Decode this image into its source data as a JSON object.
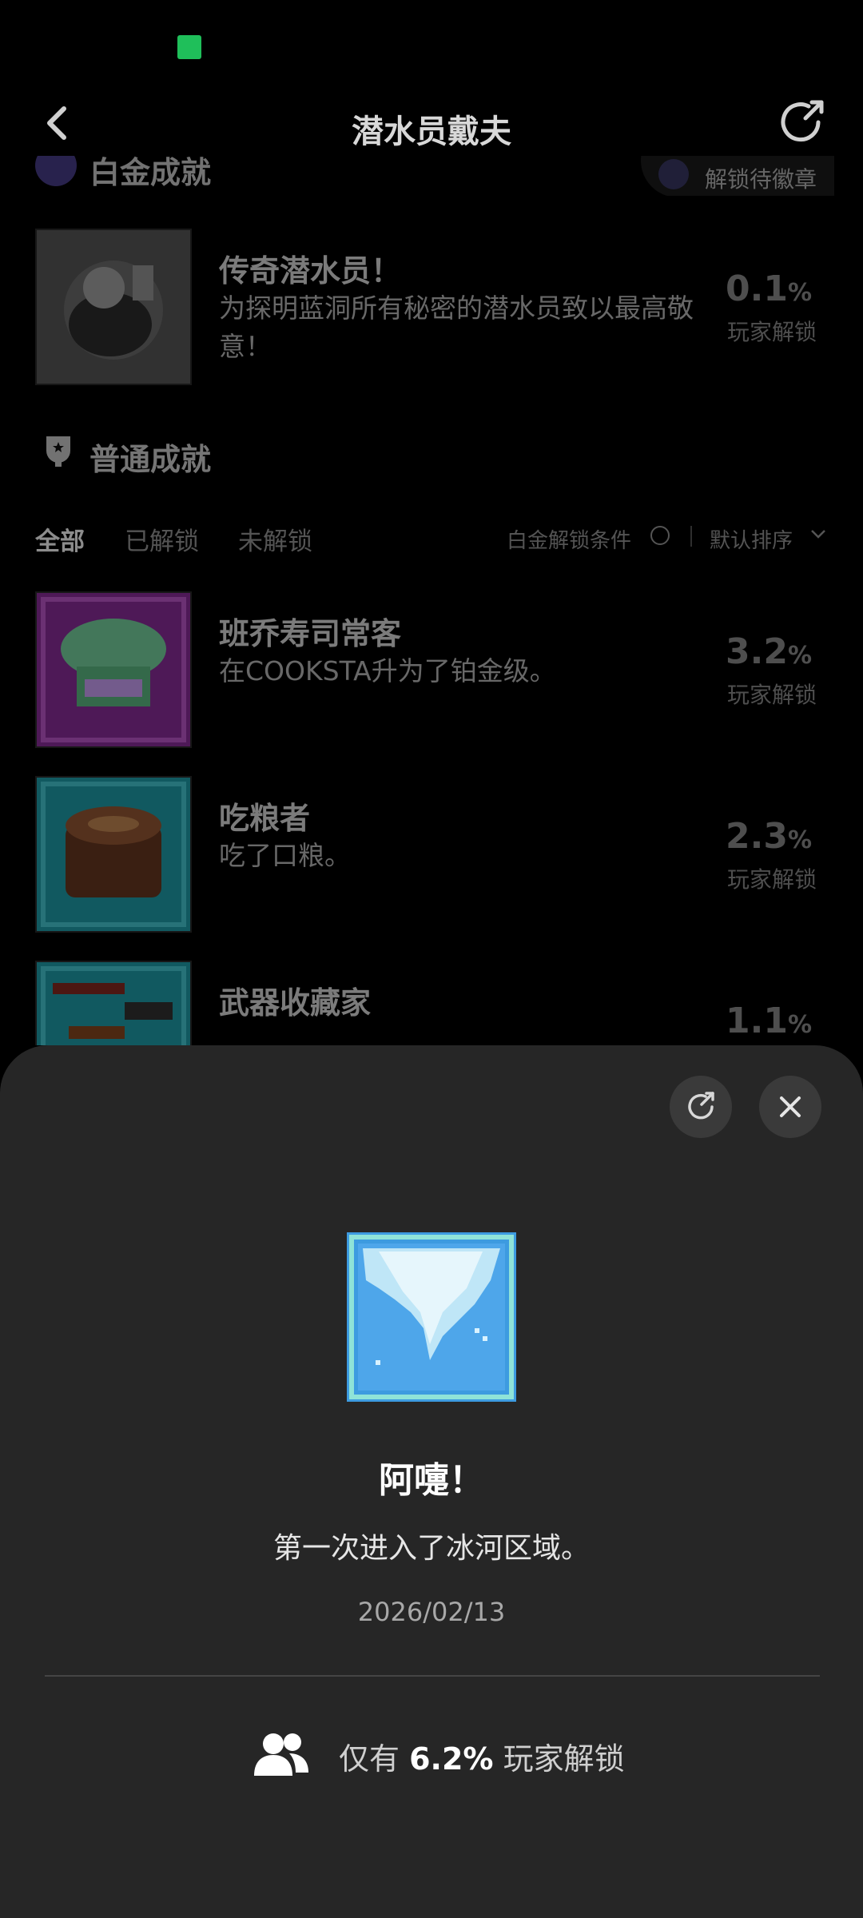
{
  "header": {
    "title": "潜水员戴夫"
  },
  "platinum": {
    "section_title": "白金成就",
    "badge_pill_label": "解锁待徽章",
    "item": {
      "name": "传奇潜水员！",
      "desc": "为探明蓝洞所有秘密的潜水员致以最高敬意！",
      "pct": "0.1",
      "pct_label": "玩家解锁"
    }
  },
  "regular": {
    "section_title": "普通成就",
    "tabs": [
      "全部",
      "已解锁",
      "未解锁"
    ],
    "condition_label": "白金解锁条件",
    "sort_label": "默认排序",
    "items": [
      {
        "name": "班乔寿司常客",
        "desc": "在COOKSTA升为了铂金级。",
        "pct": "3.2",
        "pct_label": "玩家解锁"
      },
      {
        "name": "吃粮者",
        "desc": "吃了口粮。",
        "pct": "2.3",
        "pct_label": "玩家解锁"
      },
      {
        "name": "武器收藏家",
        "desc": "",
        "pct": "1.1",
        "pct_label": "玩家解锁"
      }
    ],
    "pct_symbol": "%"
  },
  "sheet": {
    "title": "阿嚏！",
    "desc": "第一次进入了冰河区域。",
    "date": "2026/02/13",
    "stat_prefix": "仅有",
    "stat_value": "6.2%",
    "stat_suffix": "玩家解锁"
  },
  "colors": {
    "background": "#000000",
    "sheet_bg": "#262626",
    "accent_ice": "#3d9be0"
  }
}
